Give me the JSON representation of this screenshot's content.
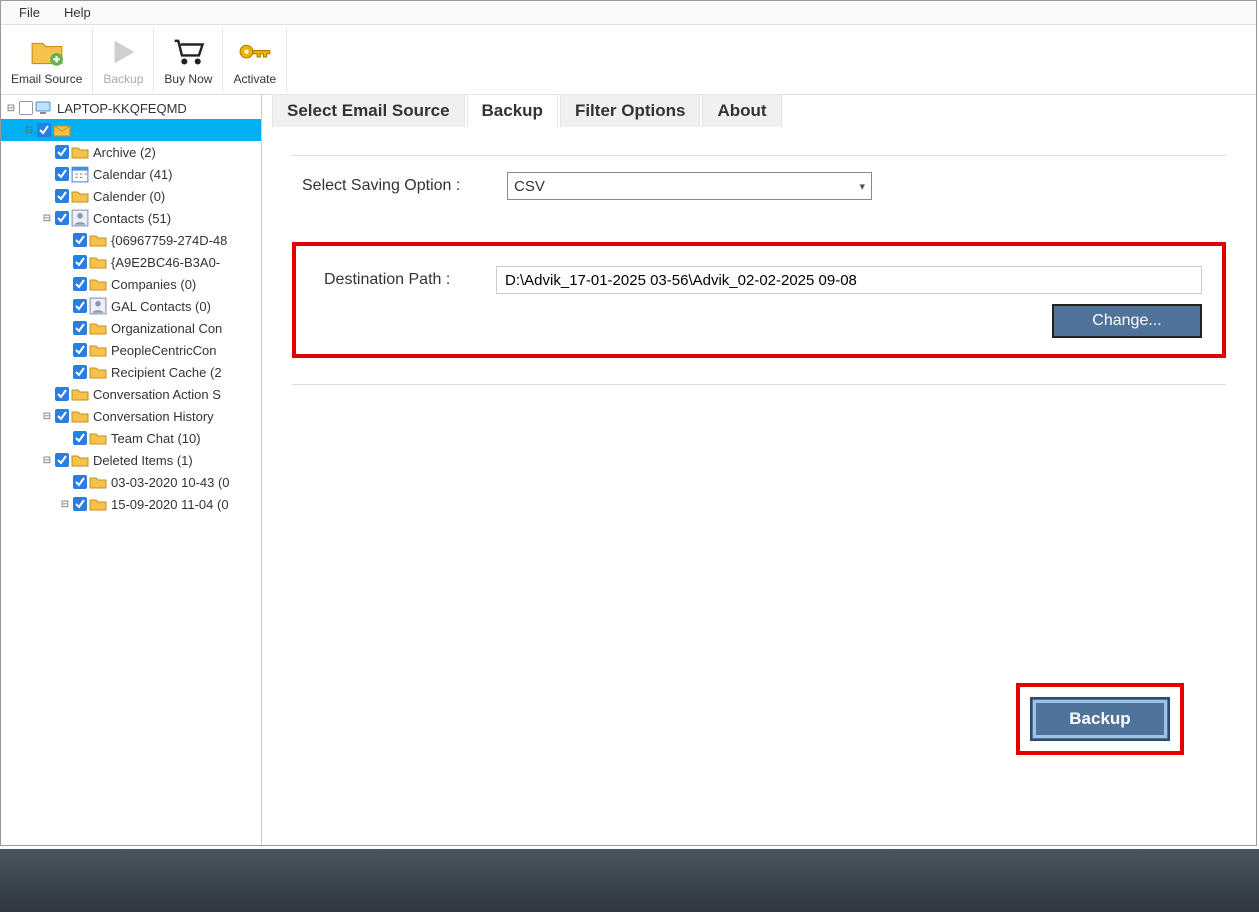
{
  "menu": {
    "file": "File",
    "help": "Help"
  },
  "toolbar": {
    "email_source": "Email Source",
    "backup": "Backup",
    "buy_now": "Buy Now",
    "activate": "Activate"
  },
  "tabs": {
    "select_source": "Select Email Source",
    "backup": "Backup",
    "filter": "Filter Options",
    "about": "About"
  },
  "form": {
    "saving_option_label": "Select Saving Option  :",
    "saving_option_value": "CSV",
    "destination_label": "Destination Path  :",
    "destination_value": "D:\\Advik_17-01-2025 03-56\\Advik_02-02-2025 09-08",
    "change_btn": "Change...",
    "backup_btn": "Backup"
  },
  "tree": {
    "root_label": "LAPTOP-KKQFEQMD",
    "nodes": [
      {
        "indent": 0,
        "expando": "-",
        "chk": false,
        "icon": "computer",
        "label": "LAPTOP-KKQFEQMD",
        "selected": false
      },
      {
        "indent": 1,
        "expando": "-",
        "chk": true,
        "icon": "mailbox",
        "label": " ",
        "selected": true
      },
      {
        "indent": 2,
        "expando": "",
        "chk": true,
        "icon": "folder",
        "label": "Archive (2)"
      },
      {
        "indent": 2,
        "expando": "",
        "chk": true,
        "icon": "calendar",
        "label": "Calendar (41)"
      },
      {
        "indent": 2,
        "expando": "",
        "chk": true,
        "icon": "folder",
        "label": "Calender (0)"
      },
      {
        "indent": 2,
        "expando": "-",
        "chk": true,
        "icon": "contacts",
        "label": "Contacts (51)"
      },
      {
        "indent": 3,
        "expando": "",
        "chk": true,
        "icon": "folder",
        "label": "{06967759-274D-48"
      },
      {
        "indent": 3,
        "expando": "",
        "chk": true,
        "icon": "folder",
        "label": "{A9E2BC46-B3A0-"
      },
      {
        "indent": 3,
        "expando": "",
        "chk": true,
        "icon": "folder",
        "label": "Companies (0)"
      },
      {
        "indent": 3,
        "expando": "",
        "chk": true,
        "icon": "contacts",
        "label": "GAL Contacts (0)"
      },
      {
        "indent": 3,
        "expando": "",
        "chk": true,
        "icon": "folder",
        "label": "Organizational Con"
      },
      {
        "indent": 3,
        "expando": "",
        "chk": true,
        "icon": "folder",
        "label": "PeopleCentricCon"
      },
      {
        "indent": 3,
        "expando": "",
        "chk": true,
        "icon": "folder",
        "label": "Recipient Cache (2"
      },
      {
        "indent": 2,
        "expando": "",
        "chk": true,
        "icon": "folder",
        "label": "Conversation Action S"
      },
      {
        "indent": 2,
        "expando": "-",
        "chk": true,
        "icon": "folder",
        "label": "Conversation History"
      },
      {
        "indent": 3,
        "expando": "",
        "chk": true,
        "icon": "folder",
        "label": "Team Chat (10)"
      },
      {
        "indent": 2,
        "expando": "-",
        "chk": true,
        "icon": "folder",
        "label": "Deleted Items (1)"
      },
      {
        "indent": 3,
        "expando": "",
        "chk": true,
        "icon": "folder",
        "label": "03-03-2020 10-43 (0"
      },
      {
        "indent": 3,
        "expando": "-",
        "chk": true,
        "icon": "folder",
        "label": "15-09-2020 11-04 (0"
      }
    ]
  }
}
